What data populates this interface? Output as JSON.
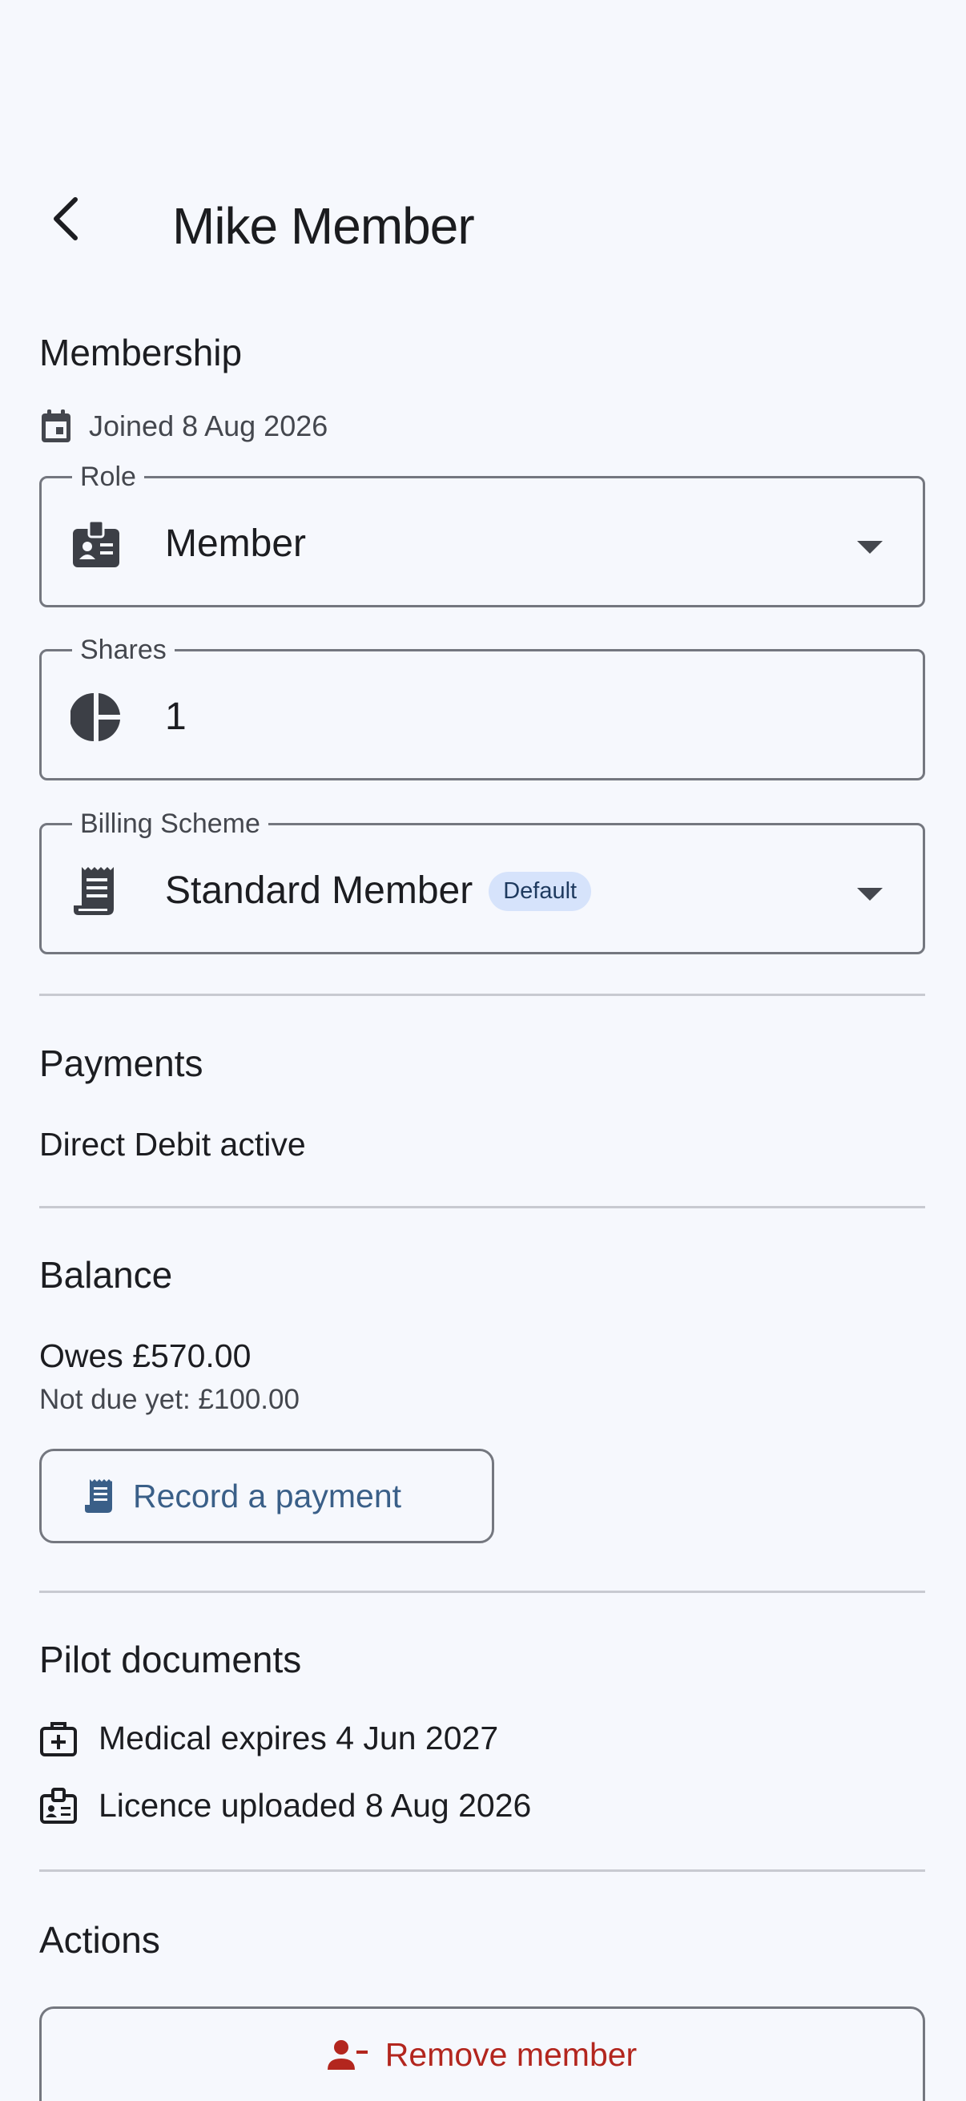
{
  "header": {
    "title": "Mike Member"
  },
  "membership": {
    "heading": "Membership",
    "joined": "Joined 8 Aug 2026",
    "role": {
      "label": "Role",
      "value": "Member"
    },
    "shares": {
      "label": "Shares",
      "value": "1"
    },
    "billing": {
      "label": "Billing Scheme",
      "value": "Standard Member",
      "badge": "Default"
    }
  },
  "payments": {
    "heading": "Payments",
    "status": "Direct Debit active"
  },
  "balance": {
    "heading": "Balance",
    "owes": "Owes £570.00",
    "not_due": "Not due yet: £100.00",
    "record_button": "Record a payment"
  },
  "pilot_documents": {
    "heading": "Pilot documents",
    "medical": "Medical expires 4 Jun 2027",
    "licence": "Licence uploaded 8 Aug 2026"
  },
  "actions": {
    "heading": "Actions",
    "remove_button": "Remove member"
  },
  "colors": {
    "background": "#f6f8fd",
    "accent": "#3a5f88",
    "danger": "#b3261e",
    "badge_bg": "#d6e3fb"
  }
}
